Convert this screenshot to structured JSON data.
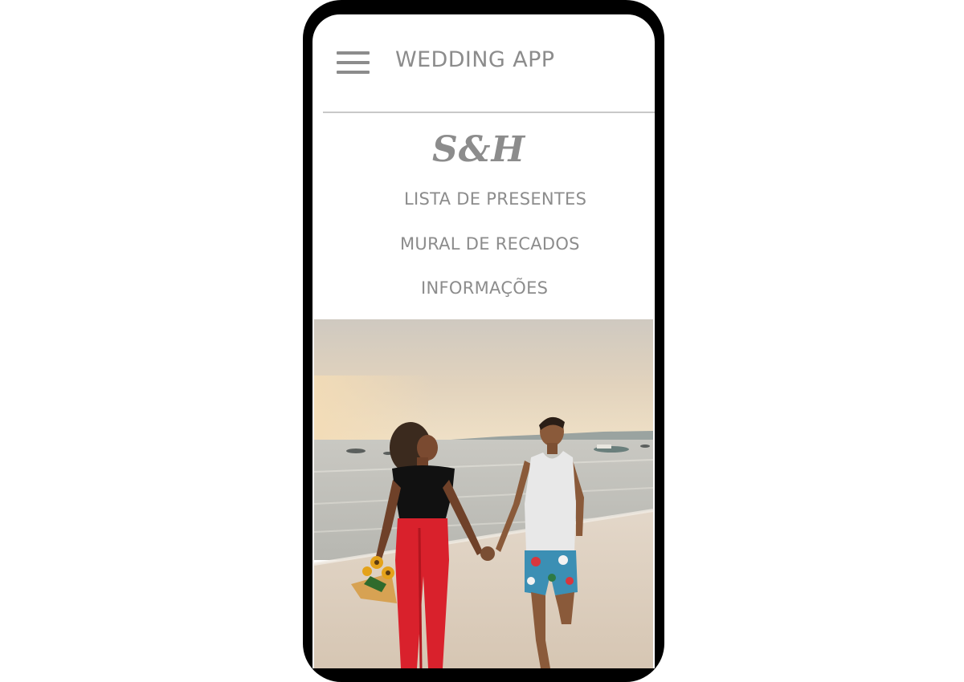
{
  "header": {
    "menu_icon": "hamburger-menu-icon",
    "app_title": "WEDDING APP"
  },
  "menu": {
    "monogram": "S&H",
    "items": [
      {
        "label": "LISTA DE PRESENTES"
      },
      {
        "label": "MURAL DE RECADOS"
      },
      {
        "label": "INFORMAÇÕES"
      }
    ]
  },
  "hero": {
    "photo": "couple-on-beach-photo"
  },
  "colors": {
    "text_gray": "#8c8c8c",
    "frame": "#000000",
    "divider": "#c8c8c8"
  }
}
